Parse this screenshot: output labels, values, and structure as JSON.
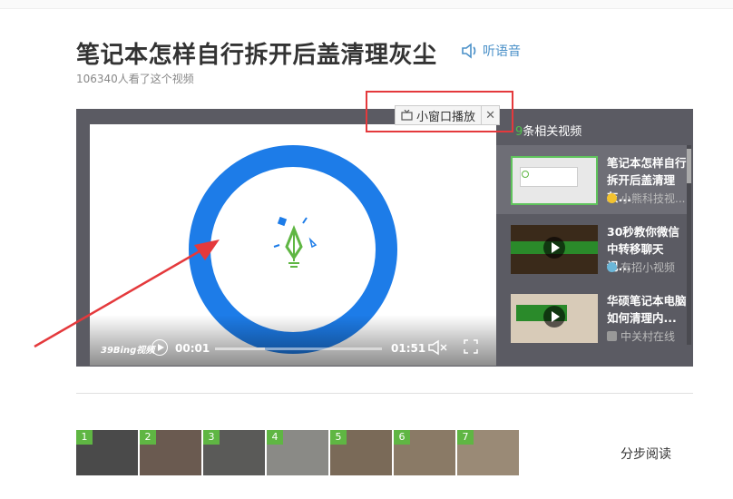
{
  "page": {
    "title": "笔记本怎样自行拆开后盖清理灰尘",
    "listen_label": "听语音",
    "views_text": "106340人看了这个视频"
  },
  "player": {
    "current_time": "00:01",
    "total_time": "01:51",
    "progress": 0.3,
    "logo_text": "39Bing视频",
    "mini_window_label": "小窗口播放",
    "close_symbol": "✕"
  },
  "related": {
    "count": "9",
    "title_suffix": "条相关视频",
    "items": [
      {
        "title": "笔记本怎样自行拆开后盖清理灰...",
        "source": "小熊科技视..."
      },
      {
        "title": "30秒教你微信中转移聊天记...",
        "source": "有招小视频"
      },
      {
        "title": "华硕笔记本电脑如何清理内...",
        "source": "中关村在线"
      }
    ]
  },
  "steps": {
    "numbers": [
      "1",
      "2",
      "3",
      "4",
      "5",
      "6",
      "7"
    ],
    "read_label": "分步阅读"
  },
  "colors": {
    "accent_blue": "#1d7ce8",
    "green": "#5fb643",
    "annotation_red": "#e4393c"
  }
}
